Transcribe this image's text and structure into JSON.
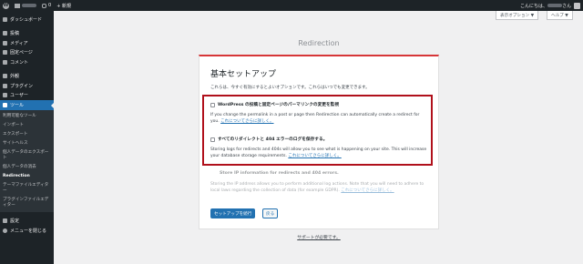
{
  "adminbar": {
    "wp_logo": "W",
    "comments_count": "0",
    "new_label": "+ 新規",
    "greeting": "こんにちは、",
    "greeting_suffix": "さん"
  },
  "sidebar": {
    "items": [
      {
        "label": "ダッシュボード",
        "icon": "dashboard-icon"
      },
      {
        "label": "投稿",
        "icon": "pin-icon"
      },
      {
        "label": "メディア",
        "icon": "media-icon"
      },
      {
        "label": "固定ページ",
        "icon": "page-icon"
      },
      {
        "label": "コメント",
        "icon": "comment-icon"
      },
      {
        "label": "外観",
        "icon": "appearance-icon"
      },
      {
        "label": "プラグイン",
        "icon": "plugin-icon"
      },
      {
        "label": "ユーザー",
        "icon": "user-icon"
      },
      {
        "label": "ツール",
        "icon": "tools-icon"
      }
    ],
    "submenu": [
      "利用可能なツール",
      "インポート",
      "エクスポート",
      "サイトヘルス",
      "個人データのエクスポート",
      "個人データの消去",
      "Redirection",
      "テーマファイルエディター",
      "プラグインファイルエディター"
    ],
    "settings": {
      "label": "設定",
      "icon": "settings-icon"
    },
    "collapse": {
      "label": "メニューを閉じる",
      "icon": "collapse-icon"
    }
  },
  "tabs": {
    "screen_options": "表示オプション ▼",
    "help": "ヘルプ ▼"
  },
  "page_heading": "Redirection",
  "card": {
    "title": "基本セットアップ",
    "intro": "これらは、今すぐ有効にするとよいオプションです。これらはいつでも変更できます。",
    "option1": {
      "label": "WordPress の投稿と固定ページのパーマリンクの変更を監視",
      "desc": "If you change the permalink in a post or page then Redirection can automatically create a redirect for you.",
      "link": "これについてさらに詳しく。"
    },
    "option2": {
      "label": "すべてのリダイレクトと 404 エラーのログを保存する。",
      "desc": "Storing logs for redirects and 404s will allow you to see what is happening on your site. This will increase your database storage requirements.",
      "link": "これについてさらに詳しく。"
    },
    "option3": {
      "label": "Store IP information for redirects and 404 errors.",
      "desc": "Storing the IP address allows you to perform additional log actions. Note that you will need to adhere to local laws regarding the collection of data (for example GDPR).",
      "link": "これについてさらに詳しく。"
    },
    "primary_button": "セットアップを続行",
    "secondary_button": "戻る"
  },
  "support_link": "サポートが必要です。",
  "colors": {
    "accent": "#2271b1",
    "highlight_border": "#b0101b",
    "admin_dark": "#1d2327"
  }
}
